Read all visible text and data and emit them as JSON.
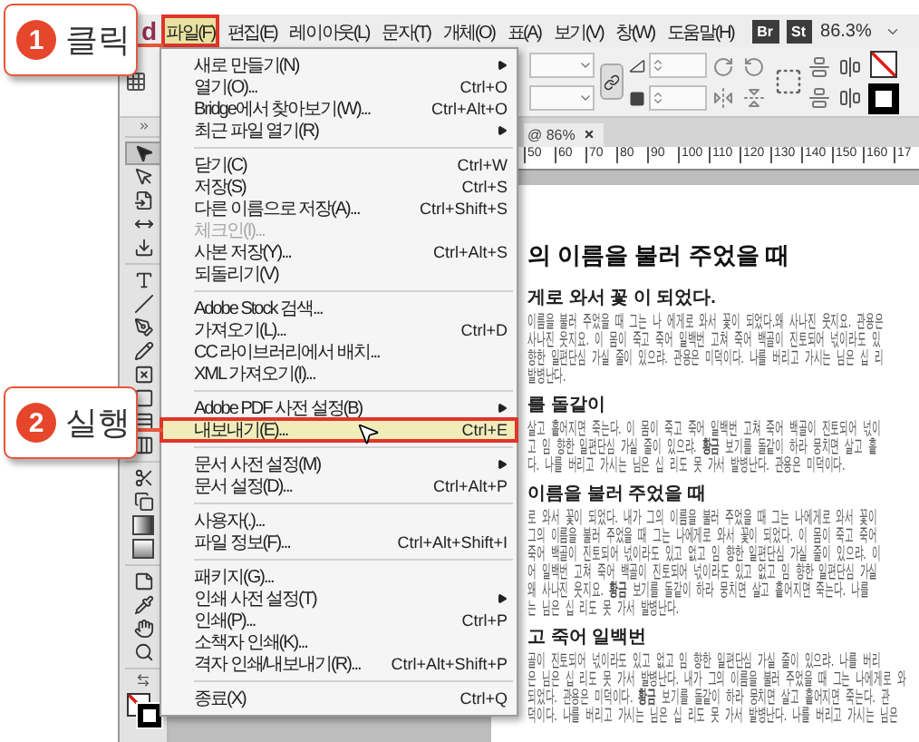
{
  "app": {
    "logo": "d"
  },
  "menubar": {
    "items": [
      {
        "label": "파일(F)",
        "selected": true
      },
      {
        "label": "편집(E)",
        "selected": false
      },
      {
        "label": "레이아웃(L)",
        "selected": false
      },
      {
        "label": "문자(T)",
        "selected": false
      },
      {
        "label": "개체(O)",
        "selected": false
      },
      {
        "label": "표(A)",
        "selected": false
      },
      {
        "label": "보기(V)",
        "selected": false
      },
      {
        "label": "창(W)",
        "selected": false
      },
      {
        "label": "도움말(H)",
        "selected": false
      }
    ],
    "bridge": "Br",
    "stock": "St",
    "zoom": "86.3%"
  },
  "toolbox": {
    "tool_groups": [
      [
        {
          "kind": "selection",
          "selected": true
        },
        {
          "kind": "direct",
          "selected": false
        },
        {
          "kind": "page",
          "selected": false
        },
        {
          "kind": "gap",
          "selected": false
        },
        {
          "kind": "collector",
          "selected": false
        }
      ],
      [
        {
          "kind": "type",
          "selected": false
        },
        {
          "kind": "line",
          "selected": false
        },
        {
          "kind": "pen",
          "selected": false
        },
        {
          "kind": "pencil",
          "selected": false
        },
        {
          "kind": "frame",
          "selected": false
        },
        {
          "kind": "rectangle",
          "selected": false
        },
        {
          "kind": "table",
          "selected": false
        },
        {
          "kind": "grid",
          "selected": false
        }
      ],
      [
        {
          "kind": "scissors",
          "selected": false
        },
        {
          "kind": "transform",
          "selected": false
        },
        {
          "kind": "gradient",
          "selected": false
        },
        {
          "kind": "feather",
          "selected": false
        }
      ],
      [
        {
          "kind": "note",
          "selected": false
        },
        {
          "kind": "eyedropper",
          "selected": false
        },
        {
          "kind": "hand",
          "selected": false
        },
        {
          "kind": "zoom",
          "selected": false
        }
      ]
    ]
  },
  "document_tab": {
    "title": "@ 86%",
    "close": "×"
  },
  "ruler": {
    "labels": [
      "50",
      "60",
      "70",
      "80",
      "90",
      "100",
      "110",
      "120",
      "130",
      "140",
      "150",
      "160",
      "17"
    ]
  },
  "file_menu": {
    "groups": [
      [
        {
          "label": "새로 만들기(N)",
          "submenu": true,
          "disabled": false,
          "selected": false
        },
        {
          "label": "열기(O)...",
          "shortcut": "Ctrl+O",
          "submenu": false,
          "disabled": false,
          "selected": false
        },
        {
          "label": "Bridge에서 찾아보기(W)...",
          "shortcut": "Ctrl+Alt+O",
          "submenu": false,
          "disabled": false,
          "selected": false
        },
        {
          "label": "최근 파일 열기(R)",
          "submenu": true,
          "disabled": false,
          "selected": false
        }
      ],
      [
        {
          "label": "닫기(C)",
          "shortcut": "Ctrl+W",
          "submenu": false,
          "disabled": false,
          "selected": false
        },
        {
          "label": "저장(S)",
          "shortcut": "Ctrl+S",
          "submenu": false,
          "disabled": false,
          "selected": false
        },
        {
          "label": "다른 이름으로 저장(A)...",
          "shortcut": "Ctrl+Shift+S",
          "submenu": false,
          "disabled": false,
          "selected": false
        },
        {
          "label": "체크인(I)...",
          "submenu": false,
          "disabled": true,
          "selected": false
        },
        {
          "label": "사본 저장(Y)...",
          "shortcut": "Ctrl+Alt+S",
          "submenu": false,
          "disabled": false,
          "selected": false
        },
        {
          "label": "되돌리기(V)",
          "submenu": false,
          "disabled": false,
          "selected": false
        }
      ],
      [
        {
          "label": "Adobe Stock 검색...",
          "submenu": false,
          "disabled": false,
          "selected": false
        },
        {
          "label": "가져오기(L)...",
          "shortcut": "Ctrl+D",
          "submenu": false,
          "disabled": false,
          "selected": false
        },
        {
          "label": "CC 라이브러리에서 배치...",
          "submenu": false,
          "disabled": false,
          "selected": false
        },
        {
          "label": "XML 가져오기(I)...",
          "submenu": false,
          "disabled": false,
          "selected": false
        }
      ],
      [
        {
          "label": "Adobe PDF 사전 설정(B)",
          "submenu": true,
          "disabled": false,
          "selected": false
        },
        {
          "label": "내보내기(E)...",
          "shortcut": "Ctrl+E",
          "submenu": false,
          "disabled": false,
          "selected": true
        }
      ],
      [
        {
          "label": "문서 사전 설정(M)",
          "submenu": true,
          "disabled": false,
          "selected": false
        },
        {
          "label": "문서 설정(D)...",
          "shortcut": "Ctrl+Alt+P",
          "submenu": false,
          "disabled": false,
          "selected": false
        }
      ],
      [
        {
          "label": "사용자(.)...",
          "submenu": false,
          "disabled": false,
          "selected": false
        },
        {
          "label": "파일 정보(F)...",
          "shortcut": "Ctrl+Alt+Shift+I",
          "submenu": false,
          "disabled": false,
          "selected": false
        }
      ],
      [
        {
          "label": "패키지(G)...",
          "submenu": false,
          "disabled": false,
          "selected": false
        },
        {
          "label": "인쇄 사전 설정(T)",
          "submenu": true,
          "disabled": false,
          "selected": false
        },
        {
          "label": "인쇄(P)...",
          "shortcut": "Ctrl+P",
          "submenu": false,
          "disabled": false,
          "selected": false
        },
        {
          "label": "소책자 인쇄(K)...",
          "submenu": false,
          "disabled": false,
          "selected": false
        },
        {
          "label": "격자 인쇄/내보내기(R)...",
          "shortcut": "Ctrl+Alt+Shift+P",
          "submenu": false,
          "disabled": false,
          "selected": false
        }
      ],
      [
        {
          "label": "종료(X)",
          "shortcut": "Ctrl+Q",
          "submenu": false,
          "disabled": false,
          "selected": false
        }
      ]
    ]
  },
  "document": {
    "blocks": [
      {
        "kind": "heading",
        "text": "의 이름을 불러 주었을 때"
      },
      {
        "kind": "subheading",
        "text": "게로 와서 꽃 이 되었다."
      },
      {
        "kind": "line",
        "text": "이름을 불러 주었을 때 그는 나 에게로 와서 꽃이 되었다.왜 사나진 웃지요. 관용은"
      },
      {
        "kind": "line",
        "text": "사나진 웃지요. 이 몸이 죽고 죽어 일백번 고쳐 죽어 백골이 진토되어 넋이라도 있"
      },
      {
        "kind": "line",
        "text": "향한 일편단심 가실 줄이 있으랴. 관용은 미덕이다. 나를 버리고 가시는 님은 십 리"
      },
      {
        "kind": "line",
        "text": "발병난다."
      },
      {
        "kind": "subheading",
        "text": "를 돌같이"
      },
      {
        "kind": "line",
        "text": "살고 흩어지면 죽는다. 이 몸이 죽고 죽어 일백번 고쳐 죽어 백골이 진토되어 넋이"
      },
      {
        "kind": "line",
        "text": "고 임 향한 일편단심 가실 줄이 있으랴. **황금** 보기를 돌같이 하라 뭉치면 살고 흩"
      },
      {
        "kind": "line",
        "text": "다. 나를 버리고 가시는 님은 십 리도 못 가서 발병난다. 관용은 미덕이다."
      },
      {
        "kind": "subheading",
        "text": "이름을 불러 주었을 때"
      },
      {
        "kind": "line",
        "text": "로 와서 꽃이 되었다. 내가 그의 이름을 불러 주었을 때 그는 나에게로 와서 꽃이"
      },
      {
        "kind": "line",
        "text": "그의 이름을 불러 주었을 때 그는 나에게로 와서 꽃이 되었다. 이 몸이 죽고 죽어"
      },
      {
        "kind": "line",
        "text": "죽어 백골이 진토되어 넋이라도 있고 없고 임 향한 일편단심 가실 줄이 있으랴. 이"
      },
      {
        "kind": "line",
        "text": "어 일백번 고쳐 죽어 백골이 진토되어 넋이라도 있고 없고 임 향한 일편단심 가실"
      },
      {
        "kind": "line",
        "text": "왜 사나진 웃지요. **황금** 보기를 돌같이 하라 뭉치면 살고 흩어지면 죽는다. 나를"
      },
      {
        "kind": "line",
        "text": "는 님은 십 리도 못 가서 발병난다."
      },
      {
        "kind": "subheading",
        "text": "고 죽어 일백번"
      },
      {
        "kind": "line",
        "text": "골이 진토되어 넋이라도 있고 없고 임 향한 일편단심 가실 줄이 있으랴. 나를 버리"
      },
      {
        "kind": "line",
        "text": "은 님은 십 리도 못 가서 발병난다. 내가 그의 이름을 불러 주었을 때 그는 나에게로 와"
      },
      {
        "kind": "line",
        "text": "되었다. 관용은 미덕이다. **황금** 보기를 돌같이 하라 뭉치면 살고 흩어지면 죽는다. 관"
      },
      {
        "kind": "line",
        "text": "덕이다. 나를 버리고 가시는 님은 십 리도 못 가서 발병난다. 나를 버리고 가시는 님은"
      }
    ]
  },
  "callouts": [
    {
      "number": "1",
      "label": "클릭"
    },
    {
      "number": "2",
      "label": "실행"
    }
  ]
}
